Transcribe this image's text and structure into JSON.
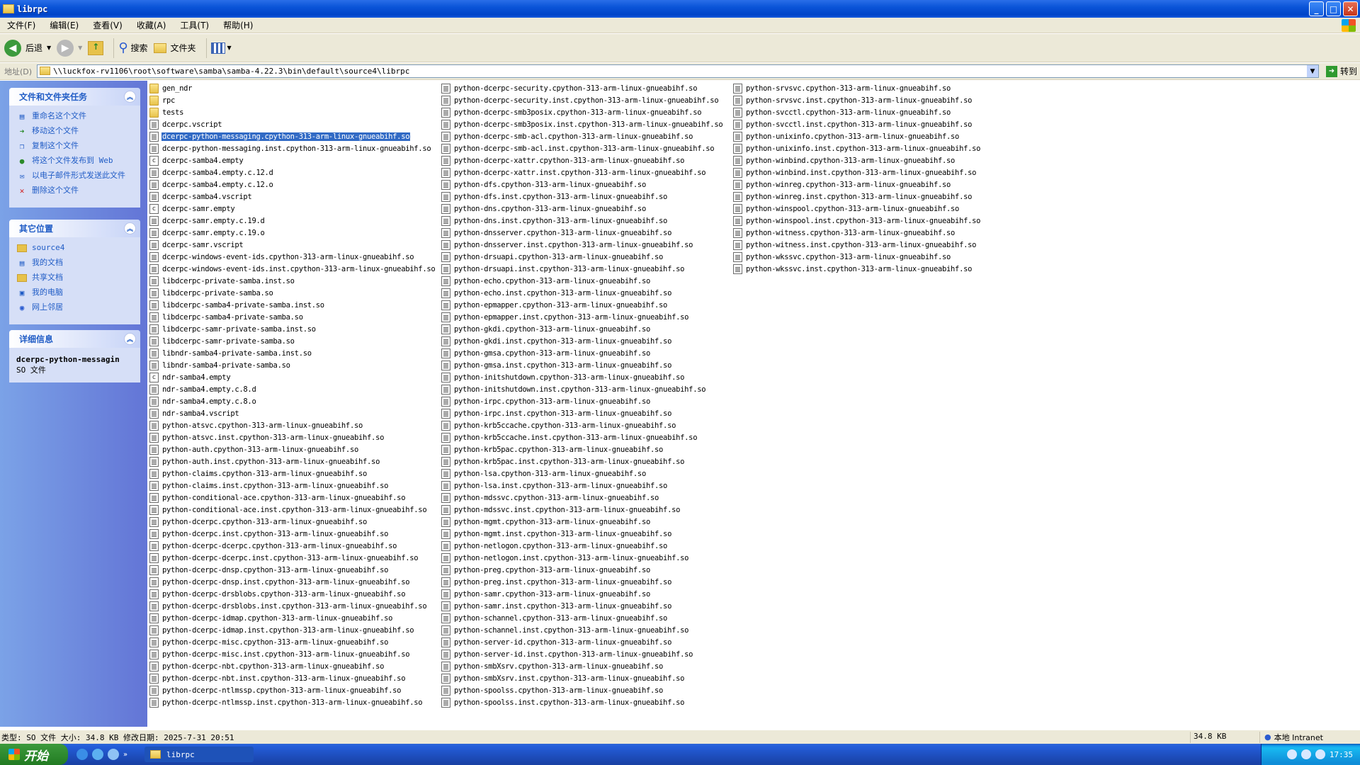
{
  "window": {
    "title": "librpc",
    "min": "_",
    "max": "□",
    "close": "✕"
  },
  "menu": [
    "文件(F)",
    "编辑(E)",
    "查看(V)",
    "收藏(A)",
    "工具(T)",
    "帮助(H)"
  ],
  "toolbar": {
    "back": "后退",
    "search": "搜索",
    "folders": "文件夹"
  },
  "address": {
    "label": "地址(D)",
    "path": "\\\\luckfox-rv1106\\root\\software\\samba\\samba-4.22.3\\bin\\default\\source4\\librpc",
    "go": "转到"
  },
  "tasks": {
    "title": "文件和文件夹任务",
    "items": [
      "重命名这个文件",
      "移动这个文件",
      "复制这个文件",
      "将这个文件发布到 Web",
      "以电子邮件形式发送此文件",
      "删除这个文件"
    ]
  },
  "other": {
    "title": "其它位置",
    "items": [
      "source4",
      "我的文档",
      "共享文档",
      "我的电脑",
      "网上邻居"
    ]
  },
  "details": {
    "title": "详细信息",
    "name": "dcerpc-python-messagin",
    "type": "SO 文件"
  },
  "files": [
    [
      "gen_ndr",
      "folder"
    ],
    [
      "rpc",
      "folder"
    ],
    [
      "tests",
      "folder"
    ],
    [
      "dcerpc.vscript",
      "file"
    ],
    [
      "dcerpc-python-messaging.cpython-313-arm-linux-gnueabihf.so",
      "file"
    ],
    [
      "dcerpc-python-messaging.inst.cpython-313-arm-linux-gnueabihf.so",
      "file"
    ],
    [
      "dcerpc-samba4.empty",
      "c"
    ],
    [
      "dcerpc-samba4.empty.c.12.d",
      "file"
    ],
    [
      "dcerpc-samba4.empty.c.12.o",
      "file"
    ],
    [
      "dcerpc-samba4.vscript",
      "file"
    ],
    [
      "dcerpc-samr.empty",
      "c"
    ],
    [
      "dcerpc-samr.empty.c.19.d",
      "file"
    ],
    [
      "dcerpc-samr.empty.c.19.o",
      "file"
    ],
    [
      "dcerpc-samr.vscript",
      "file"
    ],
    [
      "dcerpc-windows-event-ids.cpython-313-arm-linux-gnueabihf.so",
      "file"
    ],
    [
      "dcerpc-windows-event-ids.inst.cpython-313-arm-linux-gnueabihf.so",
      "file"
    ],
    [
      "libdcerpc-private-samba.inst.so",
      "file"
    ],
    [
      "libdcerpc-private-samba.so",
      "file"
    ],
    [
      "libdcerpc-samba4-private-samba.inst.so",
      "file"
    ],
    [
      "libdcerpc-samba4-private-samba.so",
      "file"
    ],
    [
      "libdcerpc-samr-private-samba.inst.so",
      "file"
    ],
    [
      "libdcerpc-samr-private-samba.so",
      "file"
    ],
    [
      "libndr-samba4-private-samba.inst.so",
      "file"
    ],
    [
      "libndr-samba4-private-samba.so",
      "file"
    ],
    [
      "ndr-samba4.empty",
      "c"
    ],
    [
      "ndr-samba4.empty.c.8.d",
      "file"
    ],
    [
      "ndr-samba4.empty.c.8.o",
      "file"
    ],
    [
      "ndr-samba4.vscript",
      "file"
    ],
    [
      "python-atsvc.cpython-313-arm-linux-gnueabihf.so",
      "file"
    ],
    [
      "python-atsvc.inst.cpython-313-arm-linux-gnueabihf.so",
      "file"
    ],
    [
      "python-auth.cpython-313-arm-linux-gnueabihf.so",
      "file"
    ],
    [
      "python-auth.inst.cpython-313-arm-linux-gnueabihf.so",
      "file"
    ],
    [
      "python-claims.cpython-313-arm-linux-gnueabihf.so",
      "file"
    ],
    [
      "python-claims.inst.cpython-313-arm-linux-gnueabihf.so",
      "file"
    ],
    [
      "python-conditional-ace.cpython-313-arm-linux-gnueabihf.so",
      "file"
    ],
    [
      "python-conditional-ace.inst.cpython-313-arm-linux-gnueabihf.so",
      "file"
    ],
    [
      "python-dcerpc.cpython-313-arm-linux-gnueabihf.so",
      "file"
    ],
    [
      "python-dcerpc.inst.cpython-313-arm-linux-gnueabihf.so",
      "file"
    ],
    [
      "python-dcerpc-dcerpc.cpython-313-arm-linux-gnueabihf.so",
      "file"
    ],
    [
      "python-dcerpc-dcerpc.inst.cpython-313-arm-linux-gnueabihf.so",
      "file"
    ],
    [
      "python-dcerpc-dnsp.cpython-313-arm-linux-gnueabihf.so",
      "file"
    ],
    [
      "python-dcerpc-dnsp.inst.cpython-313-arm-linux-gnueabihf.so",
      "file"
    ],
    [
      "python-dcerpc-drsblobs.cpython-313-arm-linux-gnueabihf.so",
      "file"
    ],
    [
      "python-dcerpc-drsblobs.inst.cpython-313-arm-linux-gnueabihf.so",
      "file"
    ],
    [
      "python-dcerpc-idmap.cpython-313-arm-linux-gnueabihf.so",
      "file"
    ],
    [
      "python-dcerpc-idmap.inst.cpython-313-arm-linux-gnueabihf.so",
      "file"
    ],
    [
      "python-dcerpc-misc.cpython-313-arm-linux-gnueabihf.so",
      "file"
    ],
    [
      "python-dcerpc-misc.inst.cpython-313-arm-linux-gnueabihf.so",
      "file"
    ],
    [
      "python-dcerpc-nbt.cpython-313-arm-linux-gnueabihf.so",
      "file"
    ],
    [
      "python-dcerpc-nbt.inst.cpython-313-arm-linux-gnueabihf.so",
      "file"
    ],
    [
      "python-dcerpc-ntlmssp.cpython-313-arm-linux-gnueabihf.so",
      "file"
    ],
    [
      "python-dcerpc-ntlmssp.inst.cpython-313-arm-linux-gnueabihf.so",
      "file"
    ],
    [
      "python-dcerpc-security.cpython-313-arm-linux-gnueabihf.so",
      "file"
    ],
    [
      "python-dcerpc-security.inst.cpython-313-arm-linux-gnueabihf.so",
      "file"
    ],
    [
      "python-dcerpc-smb3posix.cpython-313-arm-linux-gnueabihf.so",
      "file"
    ],
    [
      "python-dcerpc-smb3posix.inst.cpython-313-arm-linux-gnueabihf.so",
      "file"
    ],
    [
      "python-dcerpc-smb-acl.cpython-313-arm-linux-gnueabihf.so",
      "file"
    ],
    [
      "python-dcerpc-smb-acl.inst.cpython-313-arm-linux-gnueabihf.so",
      "file"
    ],
    [
      "python-dcerpc-xattr.cpython-313-arm-linux-gnueabihf.so",
      "file"
    ],
    [
      "python-dcerpc-xattr.inst.cpython-313-arm-linux-gnueabihf.so",
      "file"
    ],
    [
      "python-dfs.cpython-313-arm-linux-gnueabihf.so",
      "file"
    ],
    [
      "python-dfs.inst.cpython-313-arm-linux-gnueabihf.so",
      "file"
    ],
    [
      "python-dns.cpython-313-arm-linux-gnueabihf.so",
      "file"
    ],
    [
      "python-dns.inst.cpython-313-arm-linux-gnueabihf.so",
      "file"
    ],
    [
      "python-dnsserver.cpython-313-arm-linux-gnueabihf.so",
      "file"
    ],
    [
      "python-dnsserver.inst.cpython-313-arm-linux-gnueabihf.so",
      "file"
    ],
    [
      "python-drsuapi.cpython-313-arm-linux-gnueabihf.so",
      "file"
    ],
    [
      "python-drsuapi.inst.cpython-313-arm-linux-gnueabihf.so",
      "file"
    ],
    [
      "python-echo.cpython-313-arm-linux-gnueabihf.so",
      "file"
    ],
    [
      "python-echo.inst.cpython-313-arm-linux-gnueabihf.so",
      "file"
    ],
    [
      "python-epmapper.cpython-313-arm-linux-gnueabihf.so",
      "file"
    ],
    [
      "python-epmapper.inst.cpython-313-arm-linux-gnueabihf.so",
      "file"
    ],
    [
      "python-gkdi.cpython-313-arm-linux-gnueabihf.so",
      "file"
    ],
    [
      "python-gkdi.inst.cpython-313-arm-linux-gnueabihf.so",
      "file"
    ],
    [
      "python-gmsa.cpython-313-arm-linux-gnueabihf.so",
      "file"
    ],
    [
      "python-gmsa.inst.cpython-313-arm-linux-gnueabihf.so",
      "file"
    ],
    [
      "python-initshutdown.cpython-313-arm-linux-gnueabihf.so",
      "file"
    ],
    [
      "python-initshutdown.inst.cpython-313-arm-linux-gnueabihf.so",
      "file"
    ],
    [
      "python-irpc.cpython-313-arm-linux-gnueabihf.so",
      "file"
    ],
    [
      "python-irpc.inst.cpython-313-arm-linux-gnueabihf.so",
      "file"
    ],
    [
      "python-krb5ccache.cpython-313-arm-linux-gnueabihf.so",
      "file"
    ],
    [
      "python-krb5ccache.inst.cpython-313-arm-linux-gnueabihf.so",
      "file"
    ],
    [
      "python-krb5pac.cpython-313-arm-linux-gnueabihf.so",
      "file"
    ],
    [
      "python-krb5pac.inst.cpython-313-arm-linux-gnueabihf.so",
      "file"
    ],
    [
      "python-lsa.cpython-313-arm-linux-gnueabihf.so",
      "file"
    ],
    [
      "python-lsa.inst.cpython-313-arm-linux-gnueabihf.so",
      "file"
    ],
    [
      "python-mdssvc.cpython-313-arm-linux-gnueabihf.so",
      "file"
    ],
    [
      "python-mdssvc.inst.cpython-313-arm-linux-gnueabihf.so",
      "file"
    ],
    [
      "python-mgmt.cpython-313-arm-linux-gnueabihf.so",
      "file"
    ],
    [
      "python-mgmt.inst.cpython-313-arm-linux-gnueabihf.so",
      "file"
    ],
    [
      "python-netlogon.cpython-313-arm-linux-gnueabihf.so",
      "file"
    ],
    [
      "python-netlogon.inst.cpython-313-arm-linux-gnueabihf.so",
      "file"
    ],
    [
      "python-preg.cpython-313-arm-linux-gnueabihf.so",
      "file"
    ],
    [
      "python-preg.inst.cpython-313-arm-linux-gnueabihf.so",
      "file"
    ],
    [
      "python-samr.cpython-313-arm-linux-gnueabihf.so",
      "file"
    ],
    [
      "python-samr.inst.cpython-313-arm-linux-gnueabihf.so",
      "file"
    ],
    [
      "python-schannel.cpython-313-arm-linux-gnueabihf.so",
      "file"
    ],
    [
      "python-schannel.inst.cpython-313-arm-linux-gnueabihf.so",
      "file"
    ],
    [
      "python-server-id.cpython-313-arm-linux-gnueabihf.so",
      "file"
    ],
    [
      "python-server-id.inst.cpython-313-arm-linux-gnueabihf.so",
      "file"
    ],
    [
      "python-smbXsrv.cpython-313-arm-linux-gnueabihf.so",
      "file"
    ],
    [
      "python-smbXsrv.inst.cpython-313-arm-linux-gnueabihf.so",
      "file"
    ],
    [
      "python-spoolss.cpython-313-arm-linux-gnueabihf.so",
      "file"
    ],
    [
      "python-spoolss.inst.cpython-313-arm-linux-gnueabihf.so",
      "file"
    ],
    [
      "python-srvsvc.cpython-313-arm-linux-gnueabihf.so",
      "file"
    ],
    [
      "python-srvsvc.inst.cpython-313-arm-linux-gnueabihf.so",
      "file"
    ],
    [
      "python-svcctl.cpython-313-arm-linux-gnueabihf.so",
      "file"
    ],
    [
      "python-svcctl.inst.cpython-313-arm-linux-gnueabihf.so",
      "file"
    ],
    [
      "python-unixinfo.cpython-313-arm-linux-gnueabihf.so",
      "file"
    ],
    [
      "python-unixinfo.inst.cpython-313-arm-linux-gnueabihf.so",
      "file"
    ],
    [
      "python-winbind.cpython-313-arm-linux-gnueabihf.so",
      "file"
    ],
    [
      "python-winbind.inst.cpython-313-arm-linux-gnueabihf.so",
      "file"
    ],
    [
      "python-winreg.cpython-313-arm-linux-gnueabihf.so",
      "file"
    ],
    [
      "python-winreg.inst.cpython-313-arm-linux-gnueabihf.so",
      "file"
    ],
    [
      "python-winspool.cpython-313-arm-linux-gnueabihf.so",
      "file"
    ],
    [
      "python-winspool.inst.cpython-313-arm-linux-gnueabihf.so",
      "file"
    ],
    [
      "python-witness.cpython-313-arm-linux-gnueabihf.so",
      "file"
    ],
    [
      "python-witness.inst.cpython-313-arm-linux-gnueabihf.so",
      "file"
    ],
    [
      "python-wkssvc.cpython-313-arm-linux-gnueabihf.so",
      "file"
    ],
    [
      "python-wkssvc.inst.cpython-313-arm-linux-gnueabihf.so",
      "file"
    ]
  ],
  "selected_file": "dcerpc-python-messaging.cpython-313-arm-linux-gnueabihf.so",
  "status": {
    "info": "类型: SO 文件 大小: 34.8 KB 修改日期: 2025-7-31 20:51",
    "size": "34.8 KB",
    "zone": "本地 Intranet"
  },
  "taskbar": {
    "start": "开始",
    "task": "librpc",
    "clock": "17:35"
  }
}
